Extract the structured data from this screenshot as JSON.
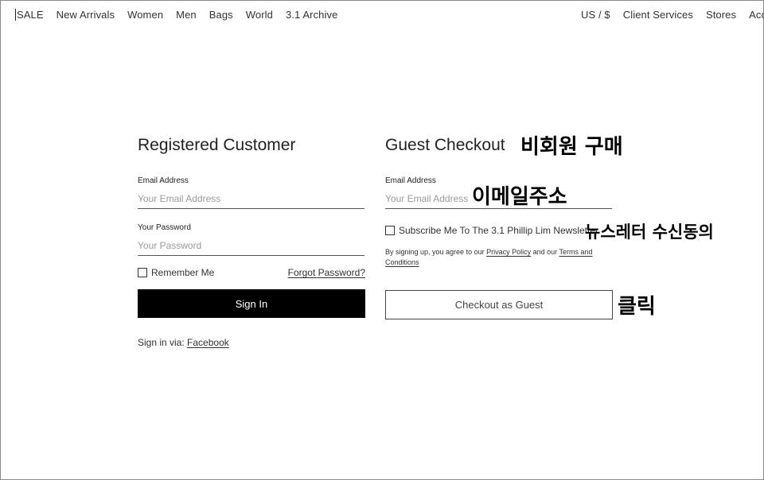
{
  "nav": {
    "left": [
      "SALE",
      "New Arrivals",
      "Women",
      "Men",
      "Bags",
      "World",
      "3.1 Archive"
    ],
    "right": [
      "US / $",
      "Client Services",
      "Stores",
      "Account"
    ]
  },
  "registered": {
    "title": "Registered Customer",
    "email_label": "Email Address",
    "email_placeholder": "Your Email Address",
    "email_value": "",
    "password_label": "Your Password",
    "password_placeholder": "Your Password",
    "password_value": "",
    "remember_label": "Remember Me",
    "remember_checked": false,
    "forgot_label": "Forgot Password?",
    "signin_label": "Sign In",
    "signin_via_text": "Sign in via:",
    "facebook_label": "Facebook"
  },
  "guest": {
    "title": "Guest Checkout",
    "email_label": "Email Address",
    "email_placeholder": "Your Email Address",
    "email_value": "",
    "subscribe_label": "Subscribe Me To The 3.1 Phillip Lim Newsletter",
    "subscribe_checked": false,
    "legal_prefix": "By signing up, you agree to our",
    "privacy_label": "Privacy Policy",
    "legal_and": "and our",
    "terms_label": "Terms and Conditions",
    "checkout_label": "Checkout as Guest"
  },
  "annotations": {
    "guest_purchase": "비회원 구매",
    "email_address": "이메일주소",
    "newsletter_consent": "뉴스레터 수신동의",
    "click": "클릭"
  }
}
